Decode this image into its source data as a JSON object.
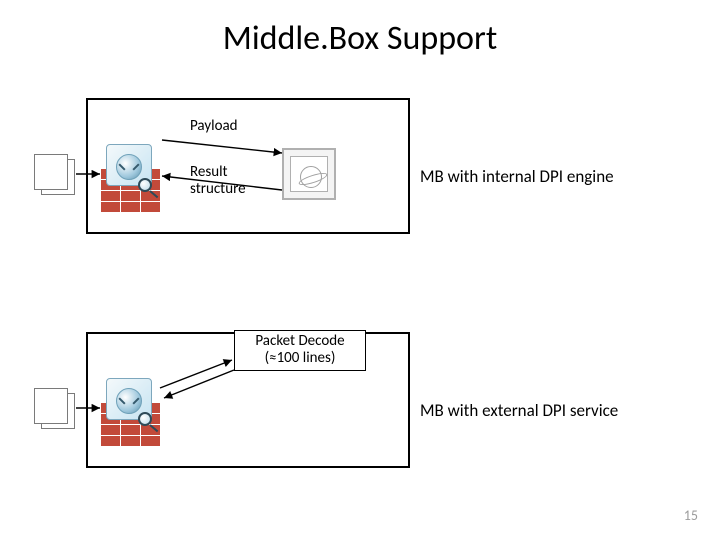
{
  "title": "Middle.Box Support",
  "diagram_top": {
    "label_payload": "Payload",
    "label_result_line1": "Result",
    "label_result_line2": "structure",
    "caption": "MB with internal DPI engine"
  },
  "diagram_bottom": {
    "decode_line1": "Packet Decode",
    "decode_line2": "(≈100 lines)",
    "caption": "MB with external DPI service"
  },
  "slide_number": "15",
  "icons": {
    "file": "config-file-icon",
    "firewall": "firewall-appliance-icon",
    "dpi": "dpi-engine-icon"
  }
}
